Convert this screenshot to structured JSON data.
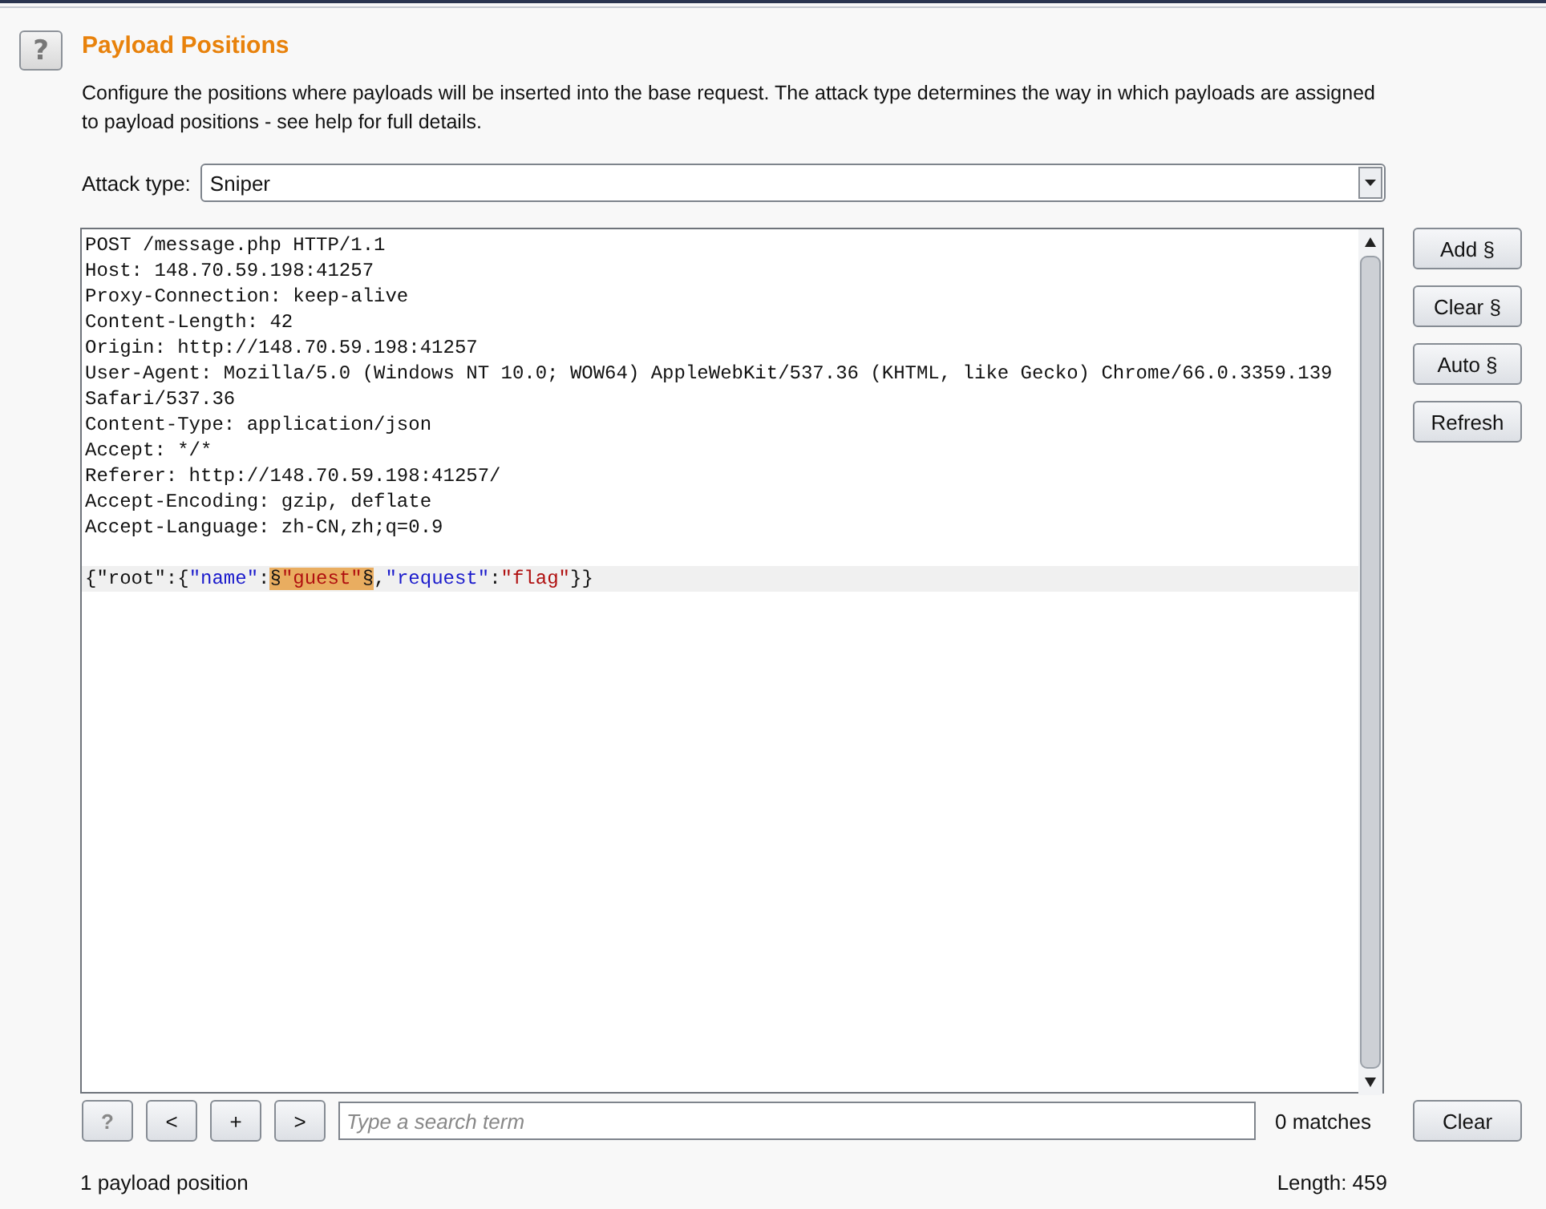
{
  "help_button": {
    "label": "?"
  },
  "title": "Payload Positions",
  "description": "Configure the positions where payloads will be inserted into the base request. The attack type determines the way in which payloads are assigned to payload positions - see help for full details.",
  "attack_type": {
    "label": "Attack type:",
    "value": "Sniper"
  },
  "editor": {
    "lines": [
      "POST /message.php HTTP/1.1",
      "Host: 148.70.59.198:41257",
      "Proxy-Connection: keep-alive",
      "Content-Length: 42",
      "Origin: http://148.70.59.198:41257",
      "User-Agent: Mozilla/5.0 (Windows NT 10.0; WOW64) AppleWebKit/537.36 (KHTML, like Gecko) Chrome/66.0.3359.139",
      "Safari/537.36",
      "Content-Type: application/json",
      "Accept: */*",
      "Referer: http://148.70.59.198:41257/",
      "Accept-Encoding: gzip, deflate",
      "Accept-Language: zh-CN,zh;q=0.9"
    ],
    "body": [
      {
        "text": "{\"root\":{",
        "kind": "plain",
        "marked": false
      },
      {
        "text": "\"name\"",
        "kind": "key",
        "marked": false
      },
      {
        "text": ":",
        "kind": "plain",
        "marked": false
      },
      {
        "text": "§",
        "kind": "plain",
        "marked": true
      },
      {
        "text": "\"guest\"",
        "kind": "string",
        "marked": true
      },
      {
        "text": "§",
        "kind": "plain",
        "marked": true
      },
      {
        "text": ",",
        "kind": "plain",
        "marked": false
      },
      {
        "text": "\"request\"",
        "kind": "key",
        "marked": false
      },
      {
        "text": ":",
        "kind": "plain",
        "marked": false
      },
      {
        "text": "\"flag\"",
        "kind": "string",
        "marked": false
      },
      {
        "text": "}}",
        "kind": "plain",
        "marked": false
      }
    ]
  },
  "side_buttons": [
    "Add §",
    "Clear §",
    "Auto §",
    "Refresh"
  ],
  "search_bar": {
    "buttons": [
      "?",
      "<",
      "+",
      ">"
    ],
    "placeholder": "Type a search term",
    "matches": "0 matches",
    "clear": "Clear"
  },
  "status": {
    "positions": "1 payload position",
    "length": "Length: 459"
  }
}
